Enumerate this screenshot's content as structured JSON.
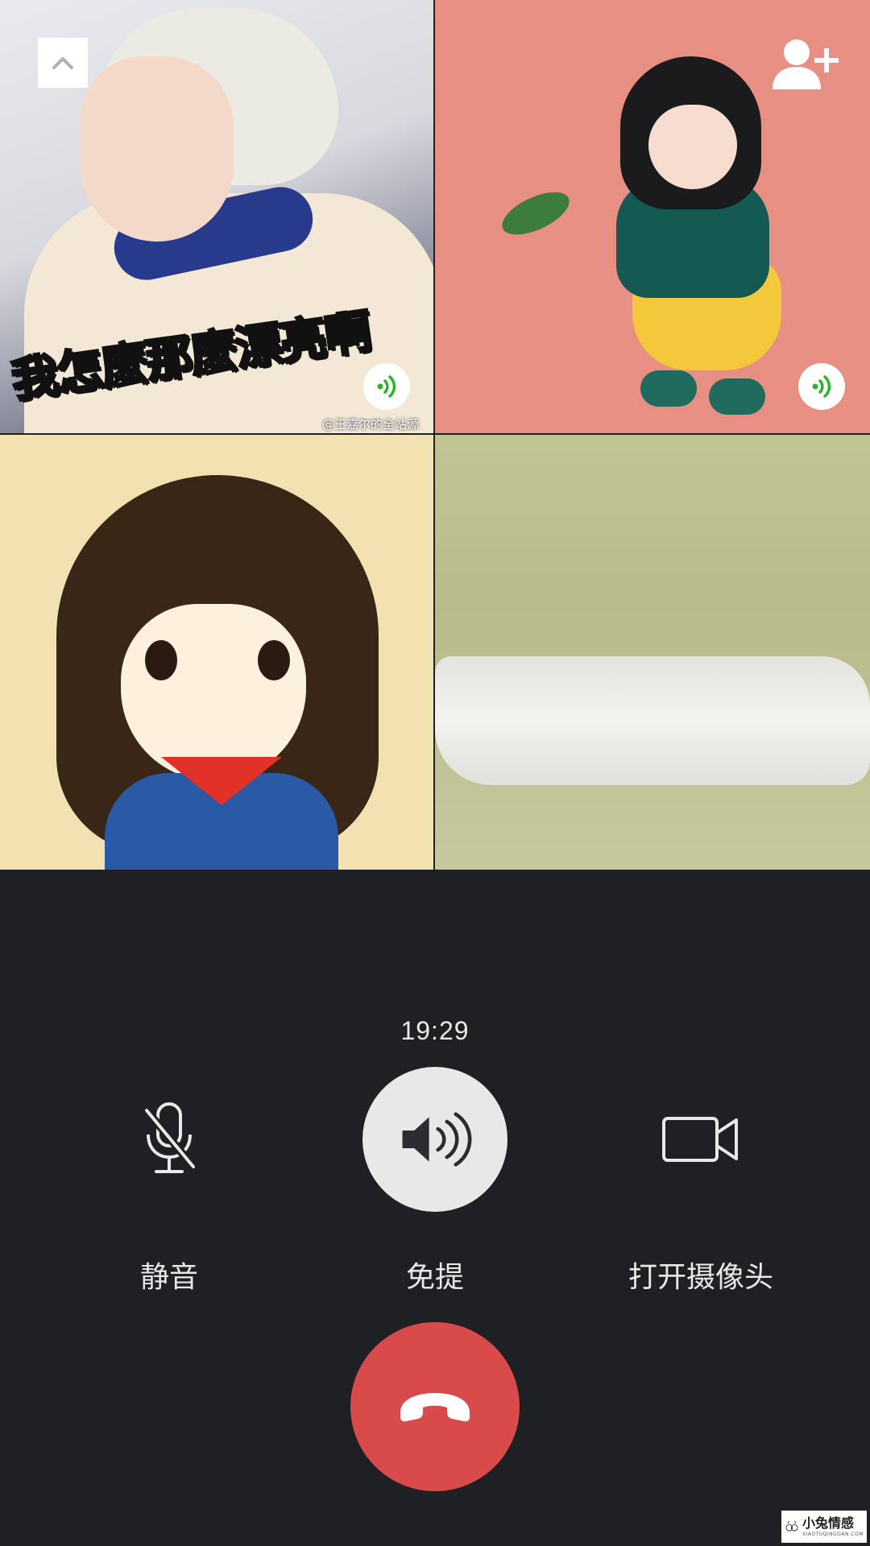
{
  "participants": [
    {
      "caption_part1": "我怎麼",
      "caption_part2": "那麼漂亮啊",
      "credit": "@王嘉尔的全站源",
      "speaking": true
    },
    {
      "speaking": true
    },
    {
      "speaking": false
    },
    {
      "speaking": false
    }
  ],
  "icons": {
    "collapse": "chevron-up-icon",
    "add_member": "add-person-icon",
    "voice": "voice-activity-icon",
    "mute": "microphone-off-icon",
    "speaker": "speaker-icon",
    "camera": "video-camera-icon",
    "hangup": "phone-hangup-icon"
  },
  "call": {
    "duration": "19:29"
  },
  "controls": {
    "mute_label": "静音",
    "speaker_label": "免提",
    "camera_label": "打开摄像头"
  },
  "watermark": {
    "text": "小兔情感",
    "subtext": "XIAOTUQINGGAN.COM"
  },
  "colors": {
    "background": "#1f2024",
    "hangup": "#d94a4a",
    "speaker_active": "#e8e8e8",
    "voice_indicator": "#2ab52a",
    "label_text": "#e8e8ea"
  }
}
